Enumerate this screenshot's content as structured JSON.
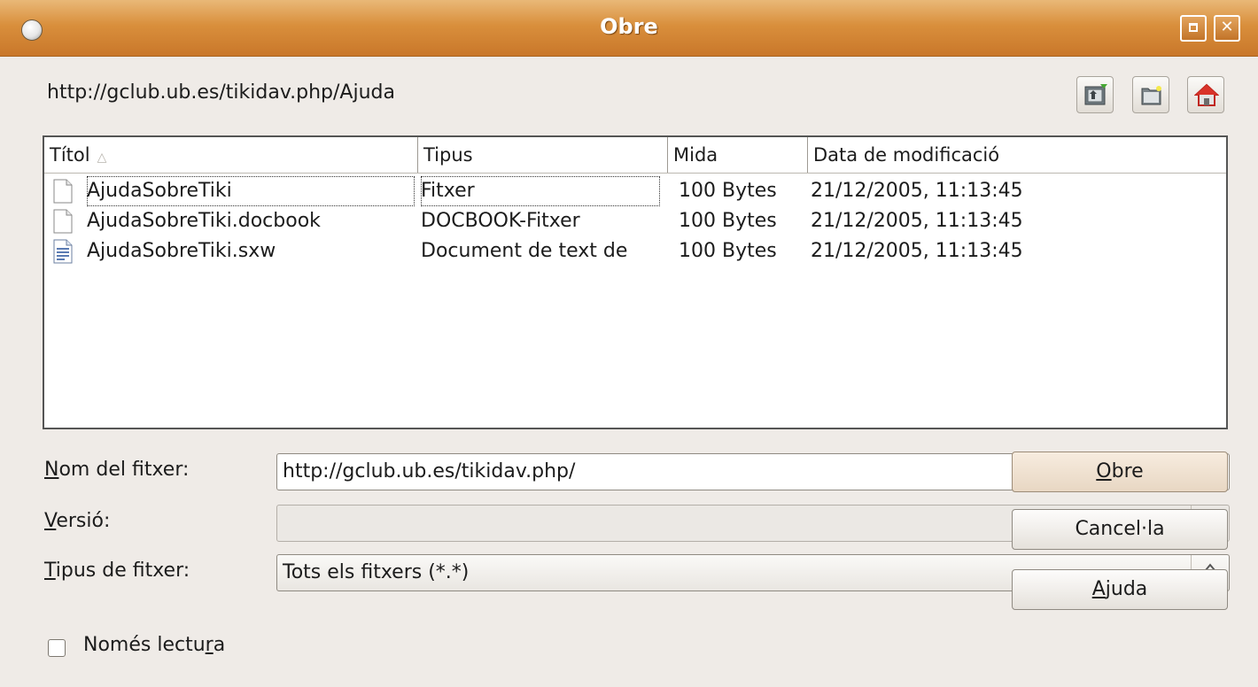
{
  "window": {
    "title": "Obre",
    "maximize_icon": "maximize-icon",
    "close_icon": "close-icon"
  },
  "location": {
    "path": "http://gclub.ub.es/tikidav.php/Ajuda"
  },
  "toolbar": {
    "up_icon": "folder-up-icon",
    "new_folder_icon": "new-folder-icon",
    "home_icon": "home-icon"
  },
  "file_list": {
    "columns": {
      "title": "Títol",
      "type": "Tipus",
      "size": "Mida",
      "date": "Data de modificació"
    },
    "sort_icon": "sort-ascending-icon",
    "rows": [
      {
        "name": "AjudaSobreTiki",
        "type": "Fitxer",
        "size": "100 Bytes",
        "date": "21/12/2005, 11:13:45",
        "icon": "blank-file-icon"
      },
      {
        "name": "AjudaSobreTiki.docbook",
        "type": "DOCBOOK-Fitxer",
        "size": "100 Bytes",
        "date": "21/12/2005, 11:13:45",
        "icon": "blank-file-icon"
      },
      {
        "name": "AjudaSobreTiki.sxw",
        "type": "Document de text de",
        "size": "100 Bytes",
        "date": "21/12/2005, 11:13:45",
        "icon": "text-document-icon"
      }
    ]
  },
  "form": {
    "filename": {
      "label_accel": "N",
      "label_rest": "om del fitxer:",
      "value": "http://gclub.ub.es/tikidav.php/"
    },
    "version": {
      "label_accel": "V",
      "label_rest": "ersió:",
      "value": ""
    },
    "filetype": {
      "label_accel": "T",
      "label_rest": "ipus de fitxer:",
      "value": "Tots els fitxers (*.*)"
    }
  },
  "buttons": {
    "open": {
      "accel": "O",
      "rest": "bre"
    },
    "cancel": {
      "label": "Cancel·la"
    },
    "help": {
      "accel": "A",
      "rest": "juda"
    }
  },
  "readonly": {
    "label_before": "Només lectu",
    "label_accel": "r",
    "label_after": "a",
    "checked": false
  }
}
